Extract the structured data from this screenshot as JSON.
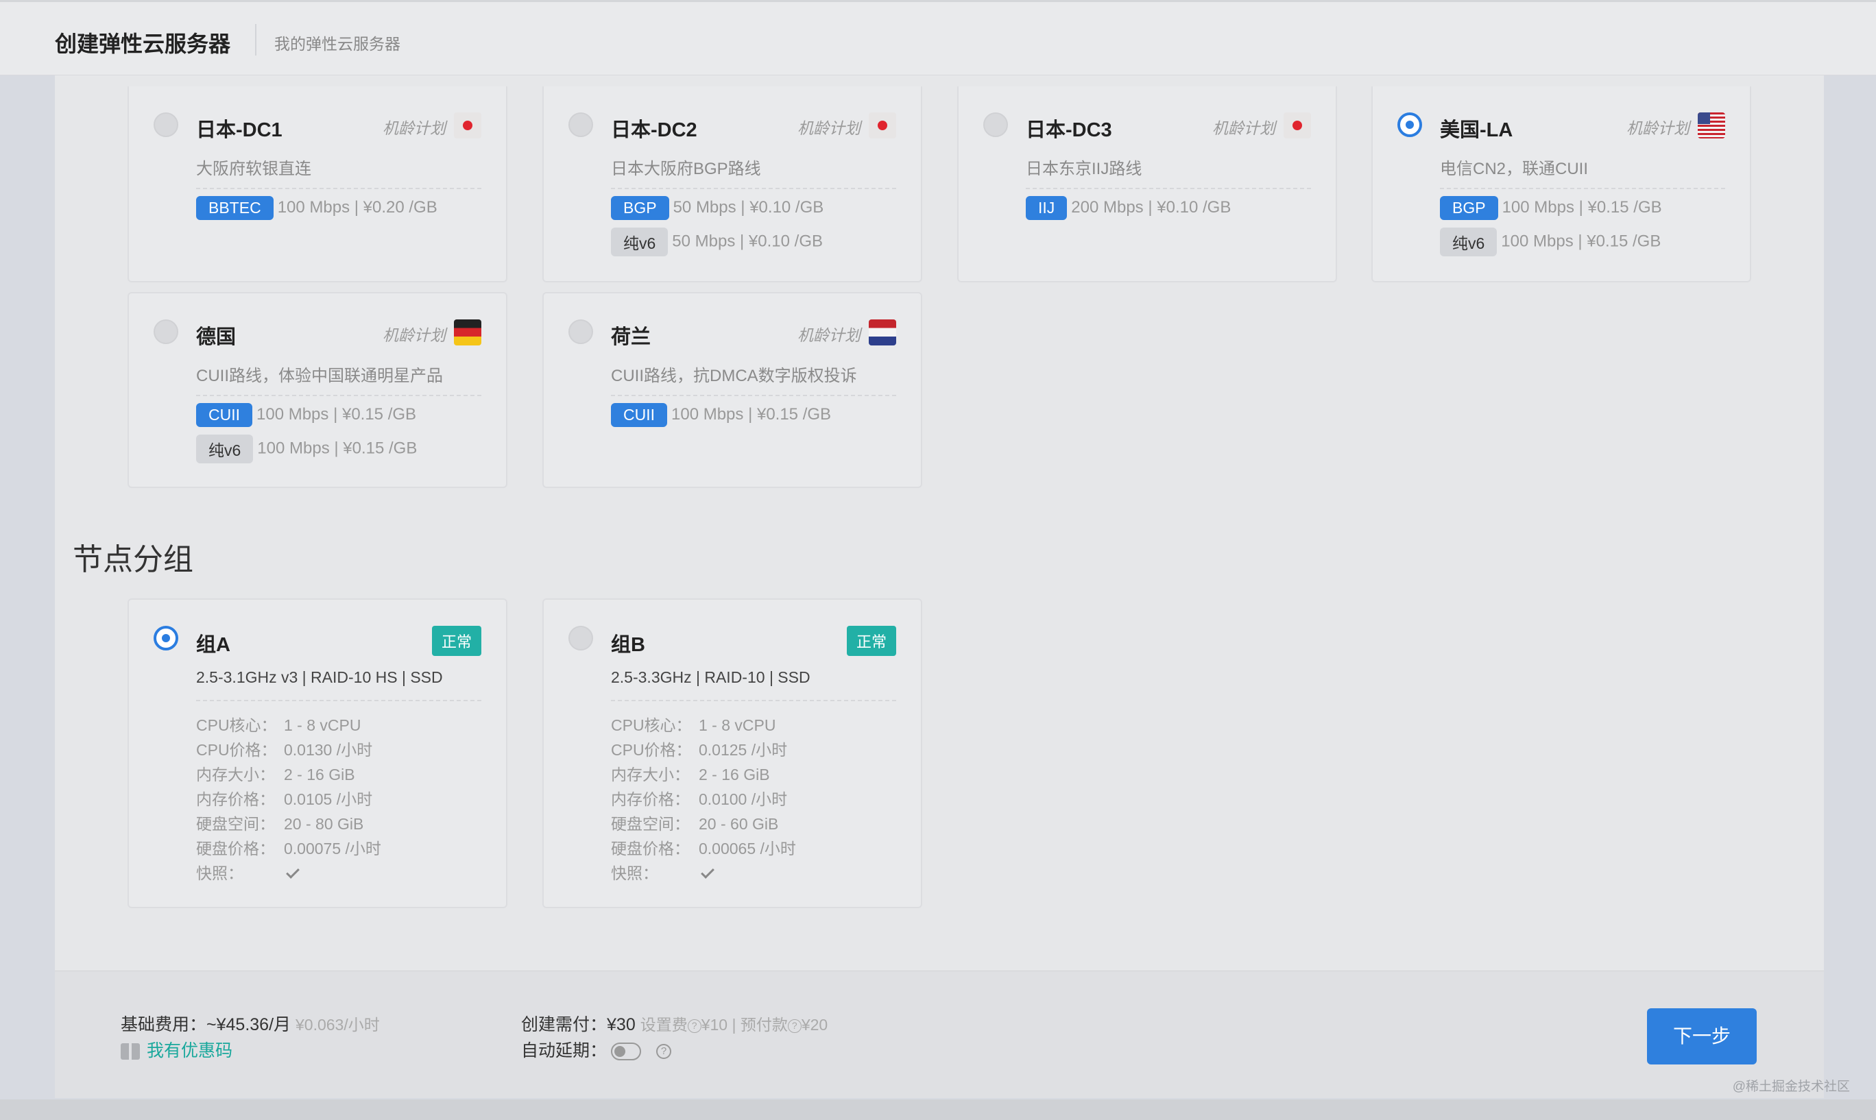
{
  "header": {
    "title": "创建弹性云服务器",
    "subtitle": "我的弹性云服务器"
  },
  "regions": [
    {
      "name": "日本-DC1",
      "plan": "机龄计划",
      "flag_icon": "japan-flag-icon",
      "description": "大阪府软银直连",
      "selected": false,
      "lines": [
        {
          "tag": "BBTEC",
          "style": "blue",
          "info": "100 Mbps | ¥0.20 /GB"
        }
      ]
    },
    {
      "name": "日本-DC2",
      "plan": "机龄计划",
      "flag_icon": "japan-flag-icon",
      "description": "日本大阪府BGP路线",
      "selected": false,
      "lines": [
        {
          "tag": "BGP",
          "style": "blue",
          "info": "50 Mbps | ¥0.10 /GB"
        },
        {
          "tag": "纯v6",
          "style": "gray",
          "info": "50 Mbps | ¥0.10 /GB"
        }
      ]
    },
    {
      "name": "日本-DC3",
      "plan": "机龄计划",
      "flag_icon": "japan-flag-icon",
      "description": "日本东京IIJ路线",
      "selected": false,
      "lines": [
        {
          "tag": "IIJ",
          "style": "blue",
          "info": "200 Mbps | ¥0.10 /GB"
        }
      ]
    },
    {
      "name": "美国-LA",
      "plan": "机龄计划",
      "flag_icon": "usa-flag-icon",
      "description": "电信CN2，联通CUII",
      "selected": true,
      "lines": [
        {
          "tag": "BGP",
          "style": "blue",
          "info": "100 Mbps | ¥0.15 /GB"
        },
        {
          "tag": "纯v6",
          "style": "gray",
          "info": "100 Mbps | ¥0.15 /GB"
        }
      ]
    },
    {
      "name": "德国",
      "plan": "机龄计划",
      "flag_icon": "germany-flag-icon",
      "description": "CUII路线，体验中国联通明星产品",
      "selected": false,
      "lines": [
        {
          "tag": "CUII",
          "style": "blue",
          "info": "100 Mbps | ¥0.15 /GB"
        },
        {
          "tag": "纯v6",
          "style": "gray",
          "info": "100 Mbps | ¥0.15 /GB"
        }
      ]
    },
    {
      "name": "荷兰",
      "plan": "机龄计划",
      "flag_icon": "netherlands-flag-icon",
      "description": "CUII路线，抗DMCA数字版权投诉",
      "selected": false,
      "lines": [
        {
          "tag": "CUII",
          "style": "blue",
          "info": "100 Mbps | ¥0.15 /GB"
        }
      ]
    }
  ],
  "node_group_section": {
    "title": "节点分组",
    "groups": [
      {
        "name": "组A",
        "status": "正常",
        "selected": true,
        "spec": "2.5-3.1GHz v3 | RAID-10 HS | SSD",
        "rows": [
          {
            "key": "CPU核心：",
            "value": "1 - 8 vCPU"
          },
          {
            "key": "CPU价格：",
            "value": "0.0130 /小时"
          },
          {
            "key": "内存大小：",
            "value": "2 - 16 GiB"
          },
          {
            "key": "内存价格：",
            "value": "0.0105 /小时"
          },
          {
            "key": "硬盘空间：",
            "value": "20 - 80 GiB"
          },
          {
            "key": "硬盘价格：",
            "value": "0.00075 /小时"
          },
          {
            "key": "快照：",
            "value": ""
          }
        ]
      },
      {
        "name": "组B",
        "status": "正常",
        "selected": false,
        "spec": "2.5-3.3GHz | RAID-10 | SSD",
        "rows": [
          {
            "key": "CPU核心：",
            "value": "1 - 8 vCPU"
          },
          {
            "key": "CPU价格：",
            "value": "0.0125 /小时"
          },
          {
            "key": "内存大小：",
            "value": "2 - 16 GiB"
          },
          {
            "key": "内存价格：",
            "value": "0.0100 /小时"
          },
          {
            "key": "硬盘空间：",
            "value": "20 - 60 GiB"
          },
          {
            "key": "硬盘价格：",
            "value": "0.00065 /小时"
          },
          {
            "key": "快照：",
            "value": ""
          }
        ]
      }
    ]
  },
  "footer": {
    "base_fee_label": "基础费用：",
    "base_fee_value": "~¥45.36/月",
    "base_fee_hourly": "¥0.063/小时",
    "coupon_label": "我有优惠码",
    "pay_label": "创建需付：",
    "pay_value": "¥30",
    "setup_fee_label": "设置费",
    "setup_fee_value": "¥10",
    "prepay_label": "预付款",
    "prepay_value": "¥20",
    "auto_renew_label": "自动延期：",
    "auto_renew_on": false,
    "help_glyph": "?",
    "next_button": "下一步"
  },
  "watermark": "@稀土掘金技术社区",
  "colors": {
    "accent": "#2f80de",
    "status_ok": "#22b0a6",
    "coupon": "#1aa89c"
  }
}
